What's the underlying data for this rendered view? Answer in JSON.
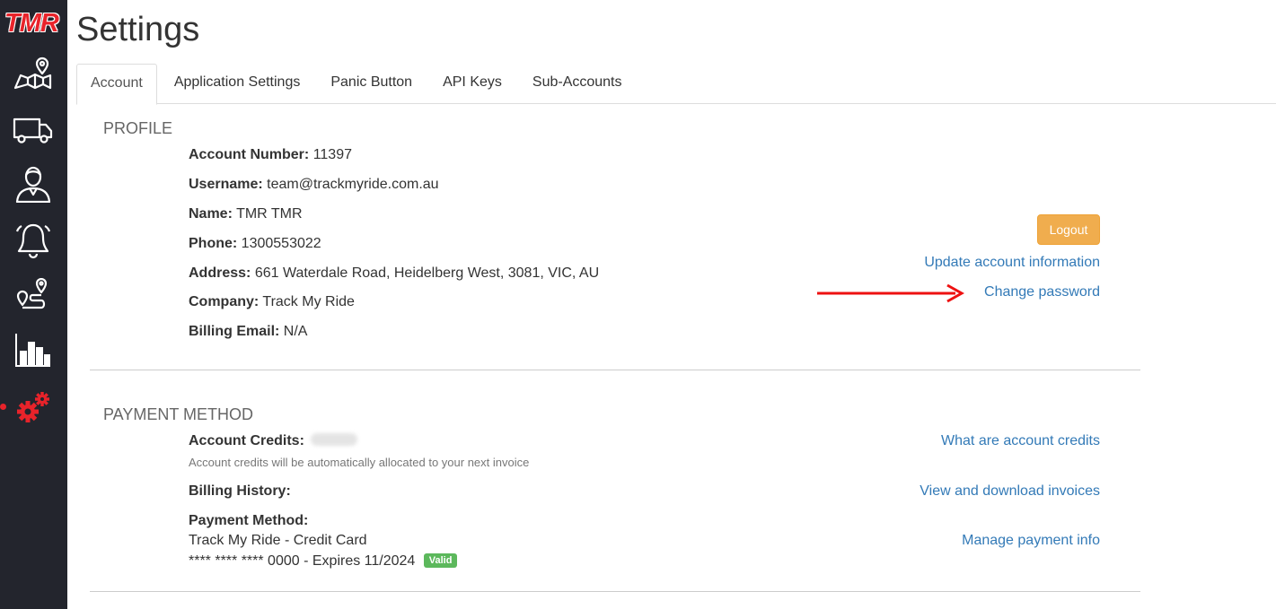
{
  "app": {
    "logo_text": "TMR"
  },
  "sidebar": {
    "items": [
      {
        "icon": "map-pin-icon"
      },
      {
        "icon": "truck-icon"
      },
      {
        "icon": "user-icon"
      },
      {
        "icon": "bell-icon"
      },
      {
        "icon": "route-icon"
      },
      {
        "icon": "bar-chart-icon"
      },
      {
        "icon": "gears-icon",
        "active": true
      }
    ],
    "active_color": "#e8232a"
  },
  "page": {
    "title": "Settings"
  },
  "tabs": [
    {
      "label": "Account",
      "active": true
    },
    {
      "label": "Application Settings"
    },
    {
      "label": "Panic Button"
    },
    {
      "label": "API Keys"
    },
    {
      "label": "Sub-Accounts"
    }
  ],
  "profile": {
    "heading": "PROFILE",
    "fields": [
      {
        "label": "Account Number:",
        "value": "11397"
      },
      {
        "label": "Username:",
        "value": "team@trackmyride.com.au"
      },
      {
        "label": "Name:",
        "value": "TMR TMR"
      },
      {
        "label": "Phone:",
        "value": "1300553022"
      },
      {
        "label": "Address:",
        "value": "661 Waterdale Road, Heidelberg West, 3081, VIC, AU"
      },
      {
        "label": "Company:",
        "value": "Track My Ride"
      },
      {
        "label": "Billing Email:",
        "value": "N/A"
      }
    ],
    "logout_label": "Logout",
    "update_link": "Update account information",
    "change_password_link": "Change password"
  },
  "payment": {
    "heading": "PAYMENT METHOD",
    "credits_label": "Account Credits:",
    "credits_hint": "Account credits will be automatically allocated to your next invoice",
    "credits_link": "What are account credits",
    "billing_history_label": "Billing History:",
    "invoices_link": "View and download invoices",
    "method_label": "Payment Method:",
    "method_name": "Track My Ride - Credit Card",
    "card_text": "**** **** **** 0000 - Expires 11/2024",
    "card_status": "Valid",
    "manage_link": "Manage payment info"
  },
  "colors": {
    "sidebar_bg": "#23252d",
    "link": "#337ab7",
    "logout_btn": "#f0ad4e",
    "valid_badge": "#5cb85c",
    "annotation_arrow": "#ee1111"
  }
}
